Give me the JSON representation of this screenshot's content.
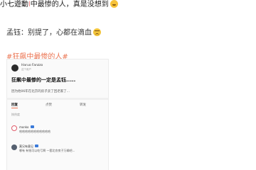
{
  "post": {
    "line1_prefix": "小七遊動",
    "line1_blurred": "l",
    "line1_text": "中最惨的人，真是没想到",
    "line2_text": "孟钰：别提了，心都在滴血",
    "hashtag": "#狂飙中最惨的人#"
  },
  "card": {
    "author_name": "Haruo Fanzzo",
    "author_sub": "这个用户",
    "question_title": "狂飙中最惨的一定是孟钰.....",
    "question_desc": "因为他06年在北京的房子卖了回老家了...",
    "tabs": [
      "回复",
      "点赞",
      "转发"
    ],
    "sort_label": "按热度",
    "comments": [
      {
        "name": "monko",
        "text": "哈哈哈哈哈哈哈哈哈哈哈"
      },
      {
        "name": "莫兄有意见",
        "text": "哪有 有钱可以吃亏啊 一套北京房子万辆吧..."
      }
    ]
  }
}
